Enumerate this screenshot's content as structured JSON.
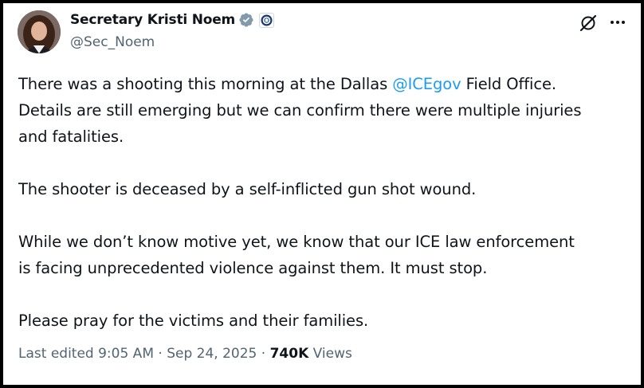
{
  "author": {
    "name": "Secretary Kristi Noem",
    "handle": "@Sec_Noem"
  },
  "tweet": {
    "line1_pre": "There was a shooting this morning at the Dallas ",
    "mention": "@ICEgov",
    "line1_post": " Field Office.",
    "line2": "Details are still emerging but we can confirm there were multiple injuries",
    "line3": "and fatalities.",
    "para2": "The shooter is deceased by a self-inflicted gun shot wound.",
    "para3_line1": "While we don’t know motive yet, we know that our ICE law enforcement",
    "para3_line2": "is facing unprecedented violence against them. It must stop.",
    "para4": "Please pray for the victims and their families."
  },
  "meta": {
    "edited": "Last edited 9:05 AM",
    "sep1": " · ",
    "date": "Sep 24, 2025",
    "sep2": " · ",
    "views_count": "740K",
    "views_label": " Views"
  },
  "colors": {
    "mention": "#1d9bf0",
    "verified_badge": "#829aab",
    "secondary_text": "#536471"
  },
  "icons": [
    "verified-badge-icon",
    "dhs-seal-icon",
    "grok-icon",
    "more-options-icon"
  ]
}
